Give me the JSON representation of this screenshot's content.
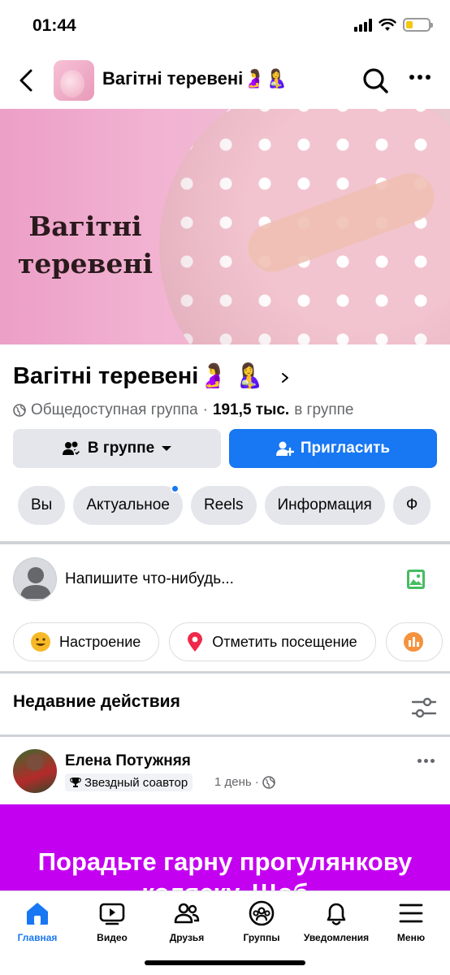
{
  "status_bar": {
    "time": "01:44",
    "battery_color": "#f2c811"
  },
  "header": {
    "title": "Вагітні теревені🤰🤱"
  },
  "cover": {
    "text": "Вагітні теревені"
  },
  "group": {
    "name": "Вагітні теревені🤰 🤱",
    "privacy": "Общедоступная группа",
    "separator": "·",
    "members_count": "191,5 тыс.",
    "members_suffix": "в группе"
  },
  "actions": {
    "member_label": "В группе",
    "invite_label": "Пригласить"
  },
  "tabs": [
    {
      "label": "Вы"
    },
    {
      "label": "Актуальное",
      "has_dot": true
    },
    {
      "label": "Reels"
    },
    {
      "label": "Информация"
    },
    {
      "label": "Ф"
    }
  ],
  "composer": {
    "placeholder": "Напишите что-нибудь..."
  },
  "chips": [
    {
      "label": "Настроение",
      "icon": "smiley-icon"
    },
    {
      "label": "Отметить посещение",
      "icon": "location-pin-icon"
    },
    {
      "label": "",
      "icon": "chart-icon"
    }
  ],
  "recent": {
    "title": "Недавние действия"
  },
  "post": {
    "author": "Елена Потужняя",
    "badge": "Звездный соавтор",
    "time": "1 день",
    "dot": "·",
    "text": "Порадьте гарну прогулянкову коляску. Щоб"
  },
  "nav": [
    {
      "label": "Главная",
      "active": true
    },
    {
      "label": "Видео"
    },
    {
      "label": "Друзья"
    },
    {
      "label": "Группы"
    },
    {
      "label": "Уведомления"
    },
    {
      "label": "Меню"
    }
  ],
  "colors": {
    "accent": "#1877f2",
    "post_bg": "#c400f0",
    "chip_gray": "#e4e6eb"
  }
}
